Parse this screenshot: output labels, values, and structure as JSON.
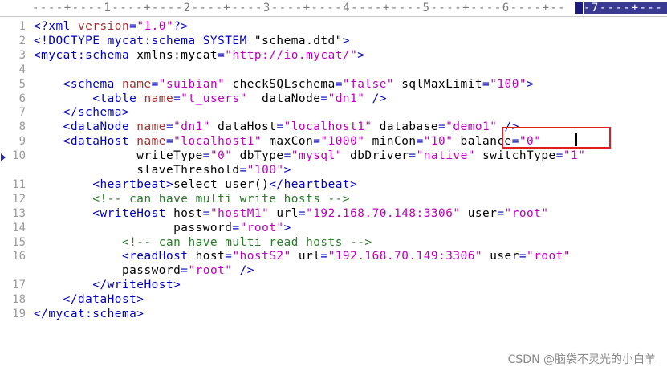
{
  "ruler": {
    "text": "----+----1----+----2----+----3----+----4----+----5----+----6----+--",
    "tab_text": "-7----+---"
  },
  "line_numbers": [
    "1",
    "2",
    "3",
    "4",
    "5",
    "6",
    "7",
    "8",
    "9",
    "10",
    "11",
    "12",
    "13",
    "14",
    "15",
    "16",
    "17",
    "18",
    "19"
  ],
  "code_lines": [
    {
      "n": "1",
      "segs": [
        [
          "t",
          "<?xml "
        ],
        [
          "a",
          "version"
        ],
        [
          "t",
          "="
        ],
        [
          "v",
          "\"1.0\""
        ],
        [
          "t",
          "?>"
        ]
      ]
    },
    {
      "n": "2",
      "segs": [
        [
          "t",
          "<!DOCTYPE mycat:schema SYSTEM "
        ],
        [
          "p",
          "\"schema.dtd\""
        ],
        [
          "t",
          ">"
        ]
      ]
    },
    {
      "n": "3",
      "segs": [
        [
          "t",
          "<mycat:schema "
        ],
        [
          "p",
          "xmlns:mycat"
        ],
        [
          "t",
          "="
        ],
        [
          "v",
          "\"http://io.mycat/\""
        ],
        [
          "t",
          ">"
        ]
      ]
    },
    {
      "n": "4",
      "segs": []
    },
    {
      "n": "5",
      "segs": [
        [
          "p",
          "    "
        ],
        [
          "t",
          "<schema "
        ],
        [
          "a",
          "name"
        ],
        [
          "t",
          "="
        ],
        [
          "v",
          "\"suibian\""
        ],
        [
          "p",
          " checkSQLschema"
        ],
        [
          "t",
          "="
        ],
        [
          "v",
          "\"false\""
        ],
        [
          "p",
          " sqlMaxLimit"
        ],
        [
          "t",
          "="
        ],
        [
          "v",
          "\"100\""
        ],
        [
          "t",
          ">"
        ]
      ]
    },
    {
      "n": "6",
      "segs": [
        [
          "p",
          "        "
        ],
        [
          "t",
          "<table "
        ],
        [
          "a",
          "name"
        ],
        [
          "t",
          "="
        ],
        [
          "v",
          "\"t_users\""
        ],
        [
          "p",
          "  dataNode"
        ],
        [
          "t",
          "="
        ],
        [
          "v",
          "\"dn1\""
        ],
        [
          "t",
          " />"
        ]
      ]
    },
    {
      "n": "7",
      "segs": [
        [
          "p",
          "    "
        ],
        [
          "t",
          "</schema>"
        ]
      ]
    },
    {
      "n": "8",
      "segs": [
        [
          "p",
          "    "
        ],
        [
          "t",
          "<dataNode "
        ],
        [
          "a",
          "name"
        ],
        [
          "t",
          "="
        ],
        [
          "v",
          "\"dn1\""
        ],
        [
          "p",
          " dataHost"
        ],
        [
          "t",
          "="
        ],
        [
          "v",
          "\"localhost1\""
        ],
        [
          "p",
          " database"
        ],
        [
          "t",
          "="
        ],
        [
          "v",
          "\"demo1\""
        ],
        [
          "t",
          " />"
        ]
      ]
    },
    {
      "n": "9",
      "segs": [
        [
          "p",
          "    "
        ],
        [
          "t",
          "<dataHost "
        ],
        [
          "a",
          "name"
        ],
        [
          "t",
          "="
        ],
        [
          "v",
          "\"localhost1\""
        ],
        [
          "p",
          " maxCon"
        ],
        [
          "t",
          "="
        ],
        [
          "v",
          "\"1000\""
        ],
        [
          "p",
          " minCon"
        ],
        [
          "t",
          "="
        ],
        [
          "v",
          "\"10\""
        ],
        [
          "p",
          " balance"
        ],
        [
          "t",
          "="
        ],
        [
          "v",
          "\"0\""
        ]
      ]
    },
    {
      "n": "10",
      "segs": [
        [
          "p",
          "              writeType"
        ],
        [
          "t",
          "="
        ],
        [
          "v",
          "\"0\""
        ],
        [
          "p",
          " dbType"
        ],
        [
          "t",
          "="
        ],
        [
          "v",
          "\"mysql\""
        ],
        [
          "p",
          " dbDriver"
        ],
        [
          "t",
          "="
        ],
        [
          "v",
          "\"native\""
        ],
        [
          "p",
          " switchType"
        ],
        [
          "t",
          "="
        ],
        [
          "v",
          "\"1\""
        ]
      ]
    },
    {
      "n": "",
      "segs": [
        [
          "p",
          "              slaveThreshold"
        ],
        [
          "t",
          "="
        ],
        [
          "v",
          "\"100\""
        ],
        [
          "t",
          ">"
        ]
      ]
    },
    {
      "n": "11",
      "segs": [
        [
          "p",
          "        "
        ],
        [
          "t",
          "<heartbeat>"
        ],
        [
          "p",
          "select user()"
        ],
        [
          "t",
          "</heartbeat>"
        ]
      ]
    },
    {
      "n": "12",
      "segs": [
        [
          "p",
          "        "
        ],
        [
          "c",
          "<!-- can have multi write hosts -->"
        ]
      ]
    },
    {
      "n": "13",
      "segs": [
        [
          "p",
          "        "
        ],
        [
          "t",
          "<writeHost "
        ],
        [
          "p",
          "host"
        ],
        [
          "t",
          "="
        ],
        [
          "v",
          "\"hostM1\""
        ],
        [
          "p",
          " url"
        ],
        [
          "t",
          "="
        ],
        [
          "v",
          "\"192.168.70.148:3306\""
        ],
        [
          "p",
          " user"
        ],
        [
          "t",
          "="
        ],
        [
          "v",
          "\"root\""
        ]
      ]
    },
    {
      "n": "14",
      "segs": [
        [
          "p",
          "                   password"
        ],
        [
          "t",
          "="
        ],
        [
          "v",
          "\"root\""
        ],
        [
          "t",
          ">"
        ]
      ]
    },
    {
      "n": "15",
      "segs": [
        [
          "p",
          "            "
        ],
        [
          "c",
          "<!-- can have multi read hosts -->"
        ]
      ]
    },
    {
      "n": "16",
      "segs": [
        [
          "p",
          "            "
        ],
        [
          "t",
          "<readHost "
        ],
        [
          "p",
          "host"
        ],
        [
          "t",
          "="
        ],
        [
          "v",
          "\"hostS2\""
        ],
        [
          "p",
          " url"
        ],
        [
          "t",
          "="
        ],
        [
          "v",
          "\"192.168.70.149:3306\""
        ],
        [
          "p",
          " user"
        ],
        [
          "t",
          "="
        ],
        [
          "v",
          "\"root\""
        ]
      ]
    },
    {
      "n": "",
      "segs": [
        [
          "p",
          "            password"
        ],
        [
          "t",
          "="
        ],
        [
          "v",
          "\"root\""
        ],
        [
          "t",
          " />"
        ]
      ]
    },
    {
      "n": "17",
      "segs": [
        [
          "p",
          "        "
        ],
        [
          "t",
          "</writeHost>"
        ]
      ]
    },
    {
      "n": "18",
      "segs": [
        [
          "p",
          "    "
        ],
        [
          "t",
          "</dataHost>"
        ]
      ]
    },
    {
      "n": "19",
      "segs": [
        [
          "t",
          "</mycat:schema>"
        ]
      ]
    }
  ],
  "watermark": "CSDN @脑袋不灵光的小白羊"
}
